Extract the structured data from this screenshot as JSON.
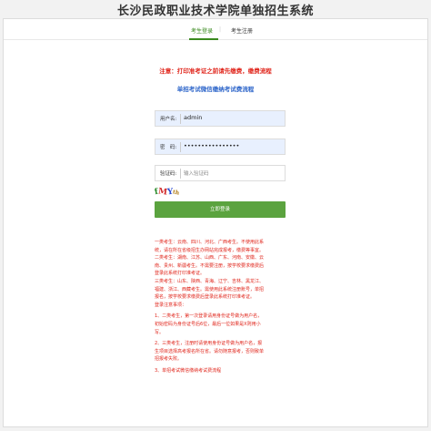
{
  "header": {
    "title": "长沙民政职业技术学院单独招生系统"
  },
  "tabs": {
    "login": "考生登录",
    "separator": "|",
    "register": "考生注册"
  },
  "notice": "注意：打印准考证之前请先缴费，缴费流程",
  "flow_link": "单招考试微信缴纳考试费流程",
  "form": {
    "username": {
      "label": "用户名:",
      "value": "admin"
    },
    "password": {
      "label": "密　码:",
      "value": "••••••••••••••••"
    },
    "captcha": {
      "label": "验证码:",
      "placeholder": "输入验证码",
      "image_text": [
        "f",
        "M",
        "Y",
        "th"
      ]
    },
    "submit_label": "立即登录"
  },
  "instructions": {
    "lines": [
      "一类考生：云南、四川、河北、广西考生。不使用此系",
      "统，请在所在省级招生办网站完成报考，缴费等事宜。",
      "二类考生：湖南、江苏、山西、广东、河南、安徽、云",
      "南、贵州、新疆考生。不需要注册，按学校要求缴费后",
      "登录此系统打印准考证。",
      "三类考生：山东、陕西、青海、辽宁、吉林、黑龙江、",
      "福建、浙江、西藏考生。需使用此系统注册账号，单招",
      "报名，按学校要求缴费后登录此系统打印准考证。",
      "登录注意事项：",
      "",
      "1、二类考生，第一次登录请用身份证号做为用户名，",
      "初始密码为身份证号后6位，最后一位如果是X则用小",
      "写。",
      "",
      "2、三类考生，注册时请使用身份证号做为用户名，报",
      "生项目选择高考报名所在省。请勿随意报考，否则致单",
      "招报考失败。",
      "",
      "3、单招考试微信缴纳考试费流程"
    ]
  },
  "colors": {
    "accent_green": "#5ba33f",
    "notice_red": "#e0251b",
    "link_blue": "#2a63c9"
  }
}
